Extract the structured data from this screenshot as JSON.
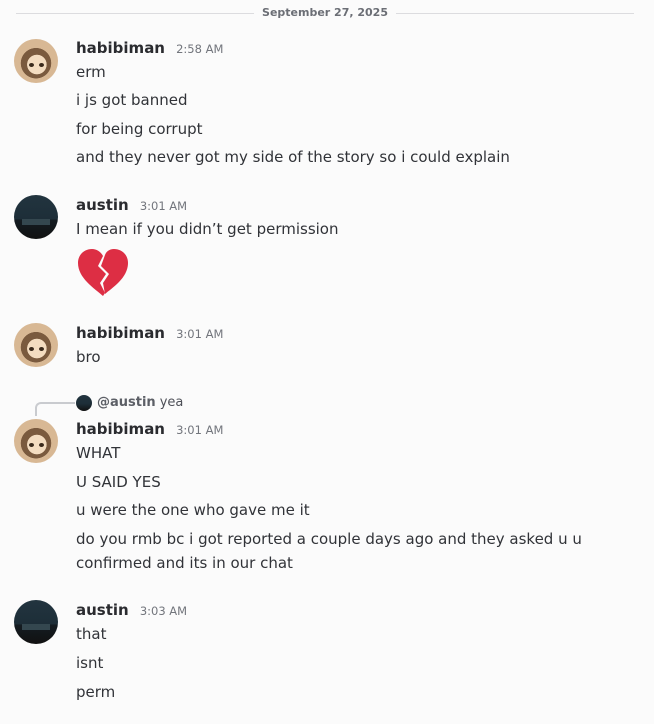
{
  "date_divider": "September 27, 2025",
  "groups": [
    {
      "username": "habibiman",
      "time": "2:58 AM",
      "avatar": "cat-avatar",
      "messages": [
        "erm",
        "i js got banned",
        "for being corrupt",
        "and they never got my side of the story so i could explain"
      ]
    },
    {
      "username": "austin",
      "time": "3:01 AM",
      "avatar": "city-night-avatar",
      "messages": [
        "I mean if you didn’t get permission"
      ],
      "emoji": "broken-heart"
    },
    {
      "username": "habibiman",
      "time": "3:01 AM",
      "avatar": "cat-avatar",
      "messages": [
        "bro"
      ]
    },
    {
      "username": "habibiman",
      "time": "3:01 AM",
      "avatar": "cat-avatar",
      "reply": {
        "mention": "@austin",
        "text": "yea"
      },
      "messages": [
        "WHAT",
        "U SAID YES",
        "u were the one who gave me it",
        "do you rmb bc i got reported a couple days ago and they asked u u confirmed and its in our chat"
      ]
    },
    {
      "username": "austin",
      "time": "3:03 AM",
      "avatar": "city-night-avatar",
      "messages": [
        "that",
        "isnt",
        "perm"
      ]
    }
  ],
  "colors": {
    "background": "#fbfbfb",
    "username": "#2a2b2f",
    "timestamp": "#72757c",
    "emoji_red": "#dd2e44"
  }
}
